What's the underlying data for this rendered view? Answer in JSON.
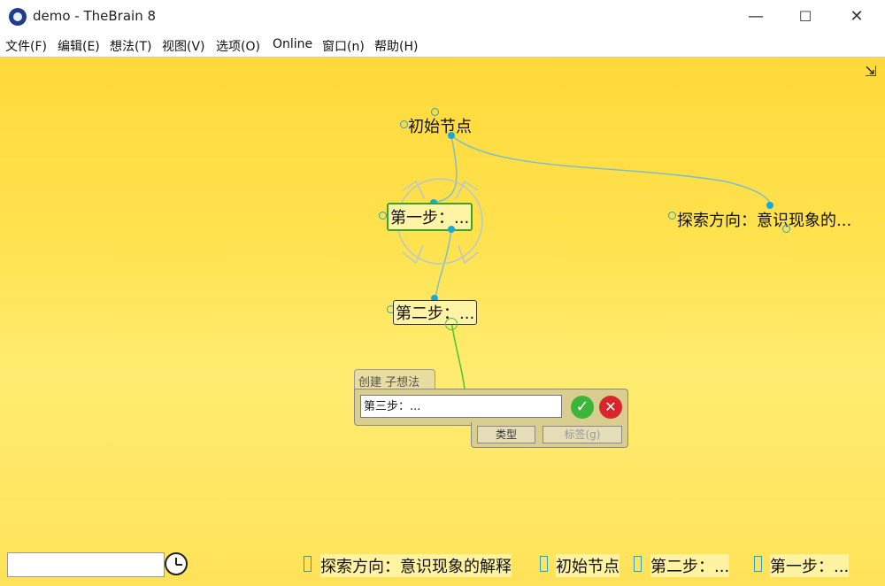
{
  "window": {
    "title": "demo - TheBrain 8",
    "minimize": "—",
    "maximize": "☐",
    "close": "✕"
  },
  "menu": [
    "文件(F)",
    "编辑(E)",
    "想法(T)",
    "视图(V)",
    "选项(O)",
    "Online",
    "窗口(n)",
    "帮助(H)"
  ],
  "nodes": {
    "root": "初始节点",
    "step1": "第一步：...",
    "step2": "第二步：...",
    "explore": "探索方向：意识现象的..."
  },
  "dialog": {
    "tab": "创建 子想法",
    "input_value": "第三步：...",
    "ok": "✓",
    "cancel": "✕",
    "type_button": "类型",
    "tag_button": "标签(g)"
  },
  "history": [
    "探索方向：意识现象的解释",
    "初始节点",
    "第二步：...",
    "第一步：..."
  ],
  "icons": {
    "corner": "collapse-icon",
    "clock": "clock-icon"
  },
  "colors": {
    "canvas_top": "#ffd93a",
    "canvas_bottom": "#ffe259",
    "link": "#7fbfc9",
    "active_link": "#4cc23a",
    "node_dot": "#19a8d8"
  }
}
